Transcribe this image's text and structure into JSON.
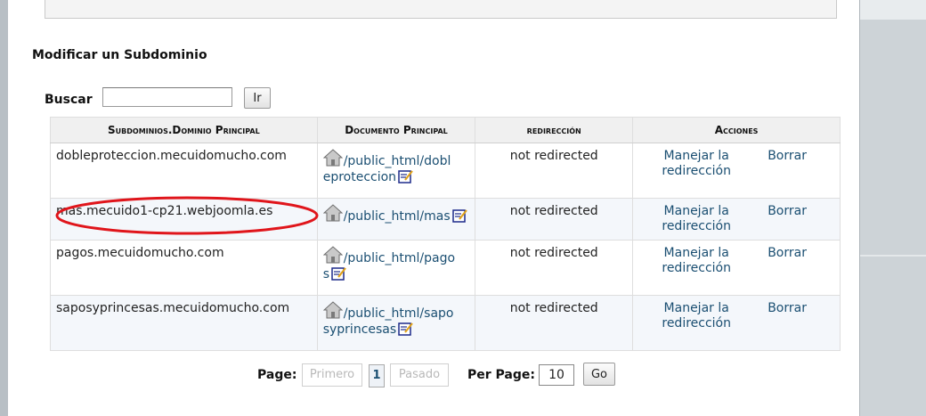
{
  "section_title": "Modificar un Subdominio",
  "search": {
    "label": "Buscar",
    "value": "",
    "button_label": "Ir"
  },
  "table": {
    "headers": [
      "Subdominios.Dominio Principal",
      "Documento Principal",
      "redirección",
      "Acciones"
    ],
    "rows": [
      {
        "subdomain": "dobleproteccion.mecuidomucho.com",
        "docroot_l1": "/public_html/dobl",
        "docroot_l2": "eproteccion",
        "redirection": "not redirected",
        "manage_l1": "Manejar la",
        "manage_l2": "redirección",
        "delete": "Borrar"
      },
      {
        "subdomain": "mas.mecuido1-cp21.webjoomla.es",
        "docroot_l1": "/public_html/mas",
        "docroot_l2": "",
        "redirection": "not redirected",
        "manage_l1": "Manejar la",
        "manage_l2": "redirección",
        "delete": "Borrar"
      },
      {
        "subdomain": "pagos.mecuidomucho.com",
        "docroot_l1": "/public_html/pago",
        "docroot_l2": "s",
        "redirection": "not redirected",
        "manage_l1": "Manejar la",
        "manage_l2": "redirección",
        "delete": "Borrar"
      },
      {
        "subdomain": "saposyprincesas.mecuidomucho.com",
        "docroot_l1": "/public_html/sapo",
        "docroot_l2": "syprincesas",
        "redirection": "not redirected",
        "manage_l1": "Manejar la",
        "manage_l2": "redirección",
        "delete": "Borrar"
      }
    ]
  },
  "pager": {
    "page_label": "Page:",
    "first_label": "Primero",
    "current_page": "1",
    "last_label": "Pasado",
    "per_page_label": "Per Page:",
    "per_page_value": "10",
    "go_label": "Go"
  },
  "icons": {
    "folder": "home-folder-icon",
    "edit": "edit-document-icon"
  },
  "colors": {
    "link": "#1b4f72",
    "highlight_annotation": "#e0151b",
    "row_alt": "#f4f7fb"
  }
}
